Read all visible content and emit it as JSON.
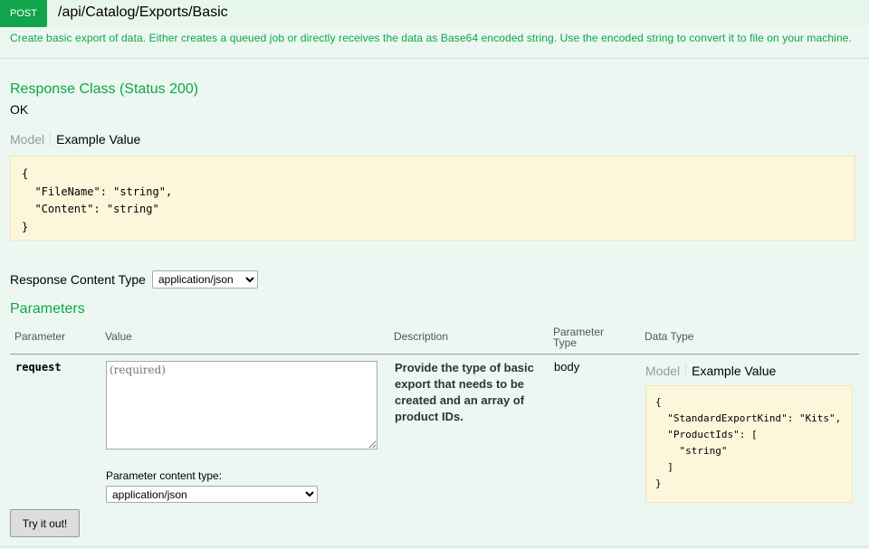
{
  "operation": {
    "method": "POST",
    "path": "/api/Catalog/Exports/Basic",
    "summary": "Create basic export of data. Either creates a queued job or directly receives the data as Base64 encoded string. Use the encoded string to convert it to file on your machine."
  },
  "response_class": {
    "title": "Response Class (Status 200)",
    "status_text": "OK",
    "tab_model": "Model",
    "tab_example": "Example Value",
    "example": "{\n  \"FileName\": \"string\",\n  \"Content\": \"string\"\n}"
  },
  "response_content_type": {
    "label": "Response Content Type",
    "selected": "application/json"
  },
  "parameters": {
    "title": "Parameters",
    "headers": {
      "parameter": "Parameter",
      "value": "Value",
      "description": "Description",
      "parameter_type_1": "Parameter",
      "parameter_type_2": "Type",
      "data_type": "Data Type"
    },
    "row": {
      "name": "request",
      "placeholder": "(required)",
      "description": "Provide the type of basic export that needs to be created and an array of product IDs.",
      "parameter_type": "body",
      "tab_model": "Model",
      "tab_example": "Example Value",
      "example": "{\n  \"StandardExportKind\": \"Kits\",\n  \"ProductIds\": [\n    \"string\"\n  ]\n}",
      "content_type_label": "Parameter content type:",
      "content_type_selected": "application/json"
    }
  },
  "try_button": "Try it out!",
  "colors": {
    "accent": "#10a54a",
    "background": "#ebf7f0",
    "code_background": "#fcf6db"
  }
}
